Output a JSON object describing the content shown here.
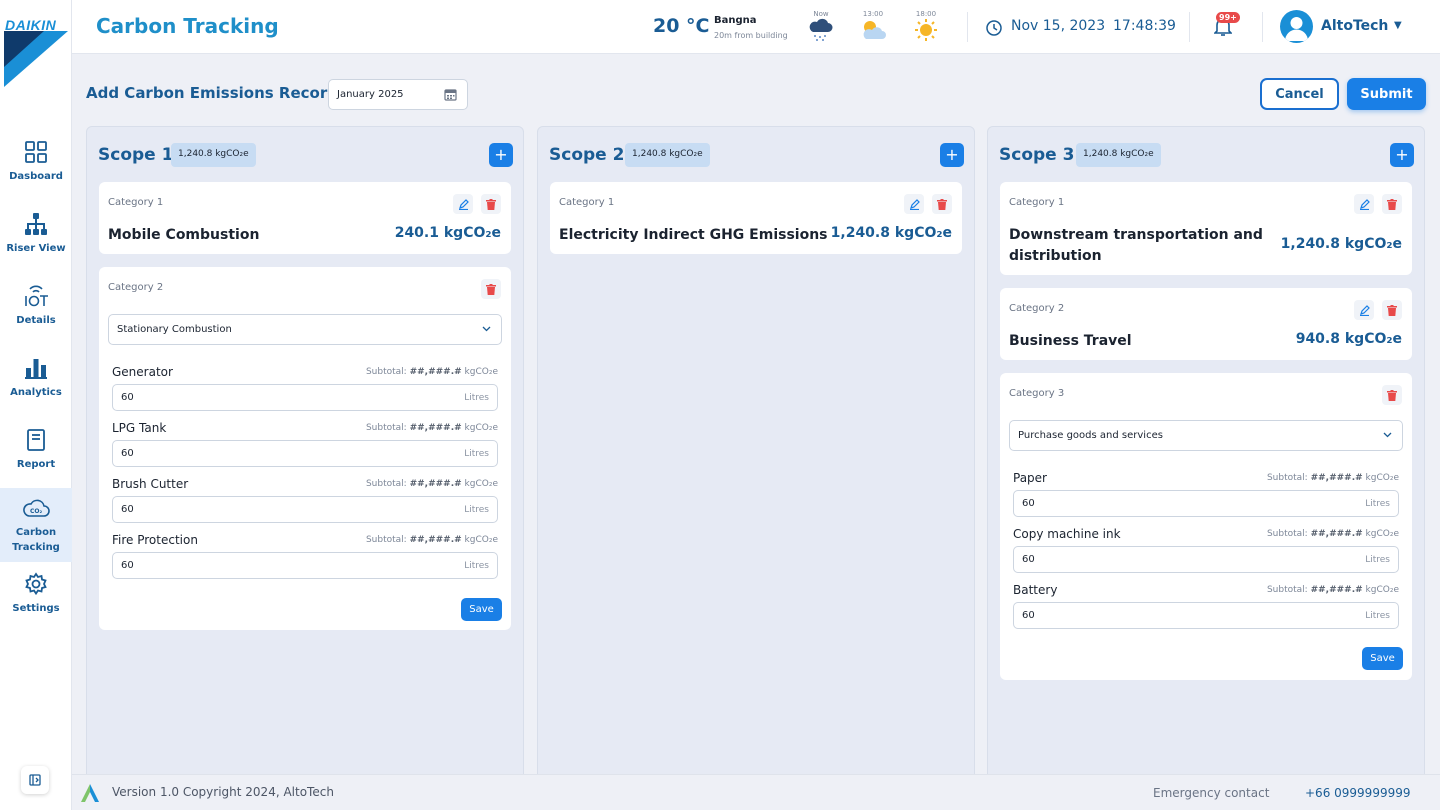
{
  "brand": {
    "logo_text": "DAIKIN"
  },
  "sidebar": {
    "items": [
      {
        "label": "Dasboard",
        "icon": "grid-icon"
      },
      {
        "label": "Riser View",
        "icon": "hierarchy-icon"
      },
      {
        "label": "Details",
        "icon": "iot-icon"
      },
      {
        "label": "Analytics",
        "icon": "bar-chart-icon"
      },
      {
        "label": "Report",
        "icon": "document-icon"
      },
      {
        "label": "Carbon Tracking",
        "icon": "co2-cloud-icon",
        "active": true
      },
      {
        "label": "Settings",
        "icon": "gear-icon"
      }
    ]
  },
  "header": {
    "title": "Carbon Tracking",
    "temperature": "20 °C",
    "location": "Bangna",
    "location_sub": "20m from building",
    "forecast": [
      {
        "time": "Now",
        "icon": "rain-cloud-icon"
      },
      {
        "time": "13:00",
        "icon": "partly-cloudy-icon"
      },
      {
        "time": "18:00",
        "icon": "sun-icon"
      }
    ],
    "date": "Nov 15, 2023",
    "time": "17:48:39",
    "notif_count": "99+",
    "user": "AltoTech"
  },
  "form": {
    "title": "Add Carbon Emissions Record",
    "month": "January 2025",
    "cancel": "Cancel",
    "submit": "Submit"
  },
  "scopes": [
    {
      "name": "Scope 1",
      "badge": "1,240.8 kgCO₂e",
      "cards": [
        {
          "category": "Category 1",
          "name": "Mobile Combustion",
          "value": "240.1 kgCO₂e"
        },
        {
          "category": "Category 2",
          "select": "Stationary Combustion",
          "items": [
            {
              "label": "Generator",
              "subtotal_label": "Subtotal:",
              "subtotal_value": "##,###.#",
              "subtotal_unit": "kgCO₂e",
              "value": "60",
              "unit": "Litres"
            },
            {
              "label": "LPG Tank",
              "subtotal_label": "Subtotal:",
              "subtotal_value": "##,###.#",
              "subtotal_unit": "kgCO₂e",
              "value": "60",
              "unit": "Litres"
            },
            {
              "label": "Brush Cutter",
              "subtotal_label": "Subtotal:",
              "subtotal_value": "##,###.#",
              "subtotal_unit": "kgCO₂e",
              "value": "60",
              "unit": "Litres"
            },
            {
              "label": "Fire Protection",
              "subtotal_label": "Subtotal:",
              "subtotal_value": "##,###.#",
              "subtotal_unit": "kgCO₂e",
              "value": "60",
              "unit": "Litres"
            }
          ],
          "save": "Save"
        }
      ]
    },
    {
      "name": "Scope 2",
      "badge": "1,240.8 kgCO₂e",
      "cards": [
        {
          "category": "Category 1",
          "name": "Electricity Indirect GHG Emissions",
          "value": "1,240.8 kgCO₂e"
        }
      ]
    },
    {
      "name": "Scope 3",
      "badge": "1,240.8 kgCO₂e",
      "cards": [
        {
          "category": "Category 1",
          "name_line1": "Downstream transportation and",
          "name_line2": "distribution",
          "value": "1,240.8 kgCO₂e"
        },
        {
          "category": "Category 2",
          "name": "Business Travel",
          "value": "940.8 kgCO₂e"
        },
        {
          "category": "Category 3",
          "select": "Purchase goods and services",
          "items": [
            {
              "label": "Paper",
              "subtotal_label": "Subtotal:",
              "subtotal_value": "##,###.#",
              "subtotal_unit": "kgCO₂e",
              "value": "60",
              "unit": "Litres"
            },
            {
              "label": "Copy machine ink",
              "subtotal_label": "Subtotal:",
              "subtotal_value": "##,###.#",
              "subtotal_unit": "kgCO₂e",
              "value": "60",
              "unit": "Litres"
            },
            {
              "label": "Battery",
              "subtotal_label": "Subtotal:",
              "subtotal_value": "##,###.#",
              "subtotal_unit": "kgCO₂e",
              "value": "60",
              "unit": "Litres"
            }
          ],
          "save": "Save"
        }
      ]
    }
  ],
  "footer": {
    "version": "Version 1.0 Copyright 2024, AltoTech",
    "emergency_label": "Emergency contact",
    "phone": "+66 0999999999"
  },
  "colors": {
    "accent": "#1a7fe6",
    "primary_text": "#1a5c94",
    "title": "#1f8fc9",
    "danger": "#e84a4a"
  }
}
